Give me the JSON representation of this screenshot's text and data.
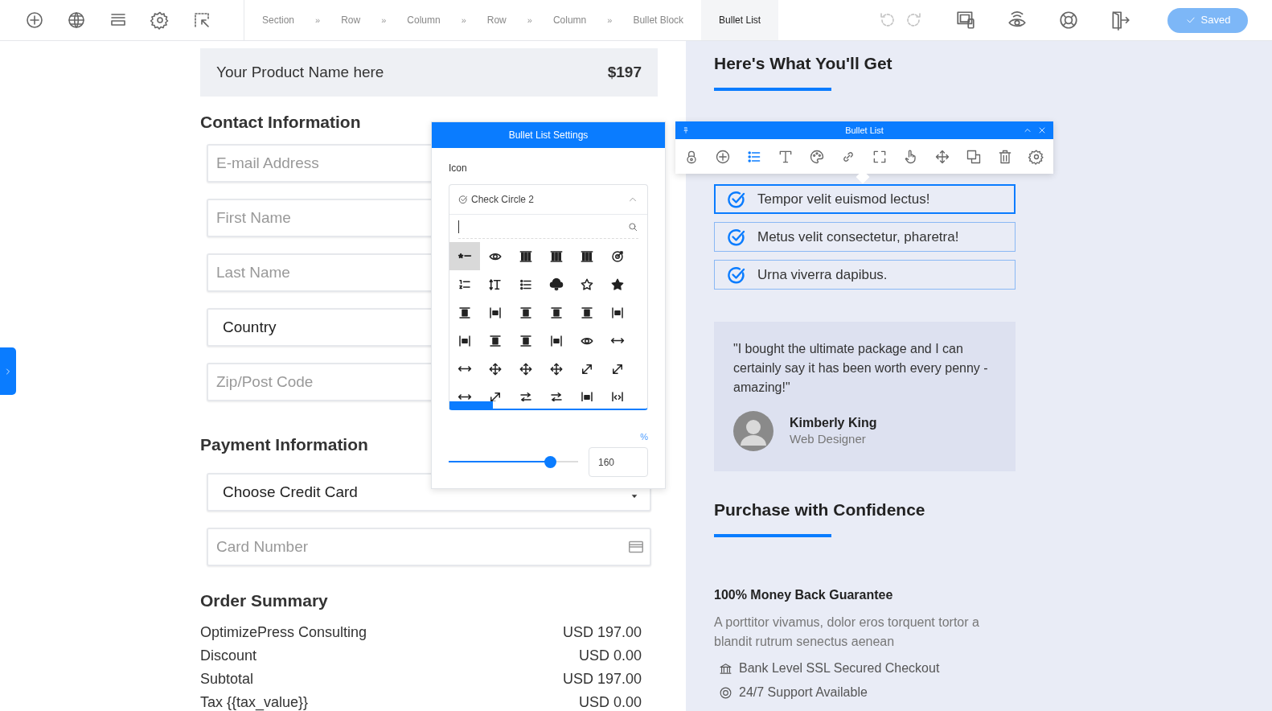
{
  "topbar": {
    "history": [
      {
        "disabled": true
      },
      {
        "disabled": true
      }
    ],
    "breadcrumb": [
      {
        "label": "Section",
        "separator": "»",
        "selected": false
      },
      {
        "label": "Row",
        "separator": "»",
        "selected": false
      },
      {
        "label": "Column",
        "separator": "»",
        "selected": false
      },
      {
        "label": "Row",
        "separator": "»",
        "selected": false
      },
      {
        "label": "Column",
        "separator": "»",
        "selected": false
      },
      {
        "label": "Bullet Block",
        "selected": false
      },
      {
        "label": "Bullet List",
        "selected": true
      }
    ],
    "saved_button": "Saved"
  },
  "checkout": {
    "product": {
      "name": "Your Product Name here",
      "price": "$197"
    },
    "contact": {
      "heading": "Contact Information",
      "fields": [
        {
          "kind": "input",
          "placeholder": "E-mail Address"
        },
        {
          "kind": "input",
          "placeholder": "First Name"
        },
        {
          "kind": "input",
          "placeholder": "Last Name"
        },
        {
          "kind": "select",
          "value": "Country"
        },
        {
          "kind": "input",
          "placeholder": "Zip/Post Code"
        }
      ]
    },
    "payment": {
      "heading": "Payment Information",
      "fields": [
        {
          "kind": "select",
          "value": "Choose Credit Card",
          "caret": true
        },
        {
          "kind": "card",
          "placeholder": "Card Number"
        }
      ]
    },
    "order_summary": {
      "heading": "Order Summary",
      "rows": [
        {
          "label": "OptimizePress Consulting",
          "amount": "USD 197.00"
        },
        {
          "label": "Discount",
          "amount": "USD 0.00"
        },
        {
          "label": "Subtotal",
          "amount": "USD 197.00"
        },
        {
          "label": "Tax {{tax_value}}",
          "amount": "USD 0.00"
        }
      ]
    }
  },
  "settings_panel": {
    "title": "Bullet List Settings",
    "icon_label": "Icon",
    "icon_select": {
      "value": "Check Circle 2",
      "expanded": true
    },
    "icon_grid": [
      {
        "selected": true
      },
      {
        "selected": false
      },
      {
        "selected": false
      },
      {
        "selected": false
      },
      {
        "selected": false
      },
      {
        "selected": false
      },
      {
        "selected": false
      },
      {
        "selected": false
      },
      {
        "selected": false
      },
      {
        "selected": false
      },
      {
        "selected": false
      },
      {
        "selected": false
      },
      {
        "selected": false
      },
      {
        "selected": false
      },
      {
        "selected": false
      },
      {
        "selected": false
      },
      {
        "selected": false
      },
      {
        "selected": false
      },
      {
        "selected": false
      },
      {
        "selected": false
      },
      {
        "selected": false
      },
      {
        "selected": false
      },
      {
        "selected": false
      },
      {
        "selected": false
      },
      {
        "selected": false
      },
      {
        "selected": false
      },
      {
        "selected": false
      },
      {
        "selected": false
      },
      {
        "selected": false
      },
      {
        "selected": false
      },
      {
        "selected": false
      },
      {
        "selected": false
      },
      {
        "selected": false
      },
      {
        "selected": false
      },
      {
        "selected": false
      },
      {
        "selected": false
      }
    ],
    "size_unit": "%",
    "size_slider": {
      "level": 0.78
    },
    "size_value": "160"
  },
  "element_toolbar": {
    "title": "Bullet List",
    "tools": [
      {
        "selected": false
      },
      {
        "selected": false
      },
      {
        "selected": true
      },
      {
        "selected": false
      },
      {
        "selected": false
      },
      {
        "selected": false
      },
      {
        "selected": false
      },
      {
        "selected": false
      },
      {
        "selected": false
      },
      {
        "selected": false
      },
      {
        "selected": false
      },
      {
        "selected": false
      }
    ]
  },
  "sales": {
    "heading": "Here's What You'll Get",
    "bullets": [
      {
        "text": "Tempor velit euismod lectus!",
        "selected": true
      },
      {
        "text": "Metus velit consectetur, pharetra!",
        "selected": false
      },
      {
        "text": "Urna viverra dapibus.",
        "selected": false
      }
    ],
    "testimonial": {
      "quote": "\"I bought the ultimate package and I can certainly say it has been worth every penny - amazing!\"",
      "name": "Kimberly King",
      "role": "Web Designer"
    },
    "guarantee": {
      "heading": "Purchase with Confidence",
      "title": "100% Money Back Guarantee",
      "body": "A porttitor vivamus, dolor eros torquent tortor a blandit rutrum senectus aenean",
      "features": [
        {
          "text": "Bank Level SSL Secured Checkout"
        },
        {
          "text": "24/7 Support Available"
        }
      ]
    }
  }
}
